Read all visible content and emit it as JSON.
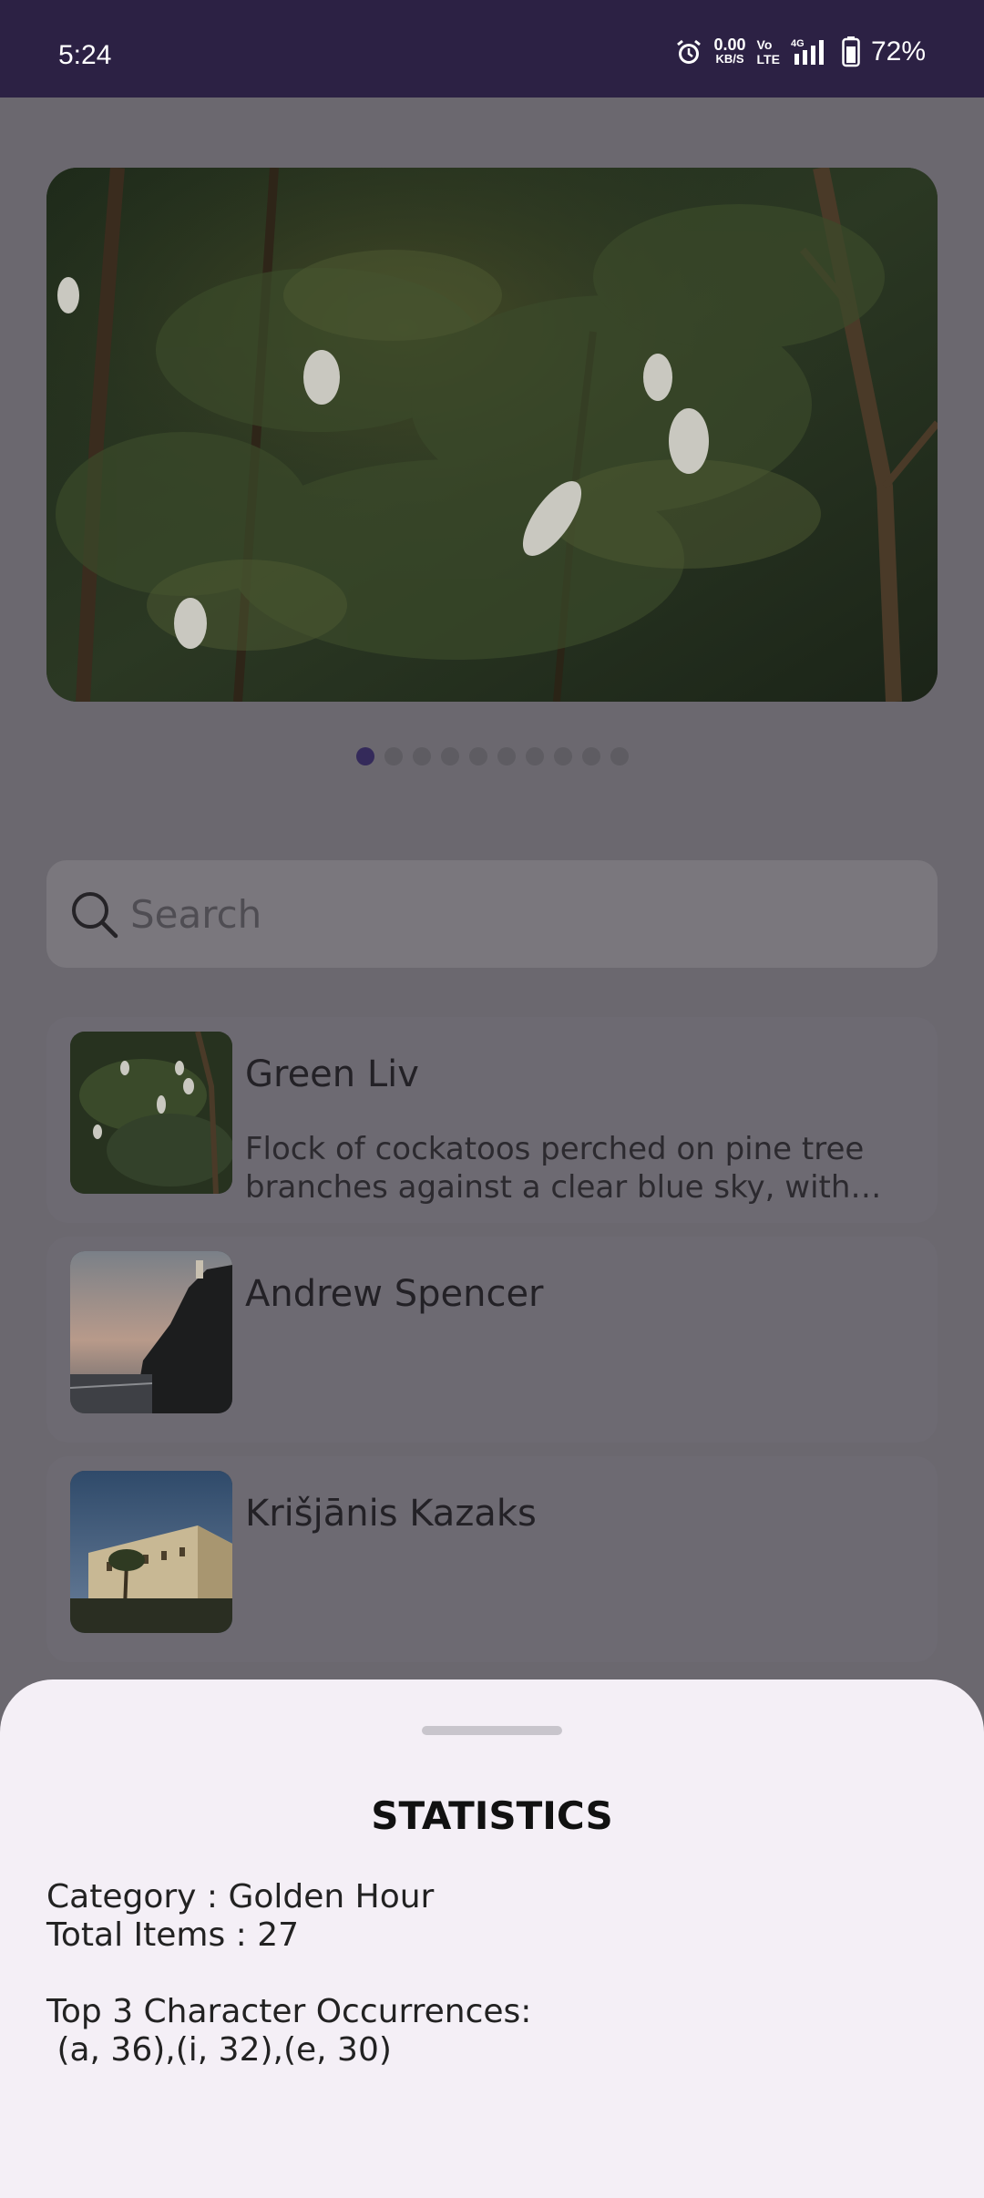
{
  "status_bar": {
    "time": "5:24",
    "net_speed": "0.00",
    "net_unit": "KB/S",
    "volte_top": "Vo",
    "volte_bottom": "LTE",
    "signal_label": "4G",
    "battery": "72%"
  },
  "carousel": {
    "page_count": 10,
    "active_index": 0
  },
  "search": {
    "placeholder": "Search"
  },
  "list": [
    {
      "title": "Green Liv",
      "description": "Flock of cockatoos perched on pine tree branches against a clear blue sky, with golden hour light filtering through the needles."
    },
    {
      "title": "Andrew Spencer",
      "description": ""
    },
    {
      "title": "Krišjānis Kazaks",
      "description": ""
    }
  ],
  "sheet": {
    "title": "STATISTICS",
    "category": "Category : Golden Hour",
    "total": "Total Items : 27",
    "top_header": "Top 3 Character Occurrences:",
    "top_values": " (a, 36),(i, 32),(e, 30)"
  },
  "colors": {
    "status_bar": "#2c2144",
    "scrim_background": "#6b686f",
    "sheet": "#f4eff6",
    "dot_active": "#342a5a"
  }
}
